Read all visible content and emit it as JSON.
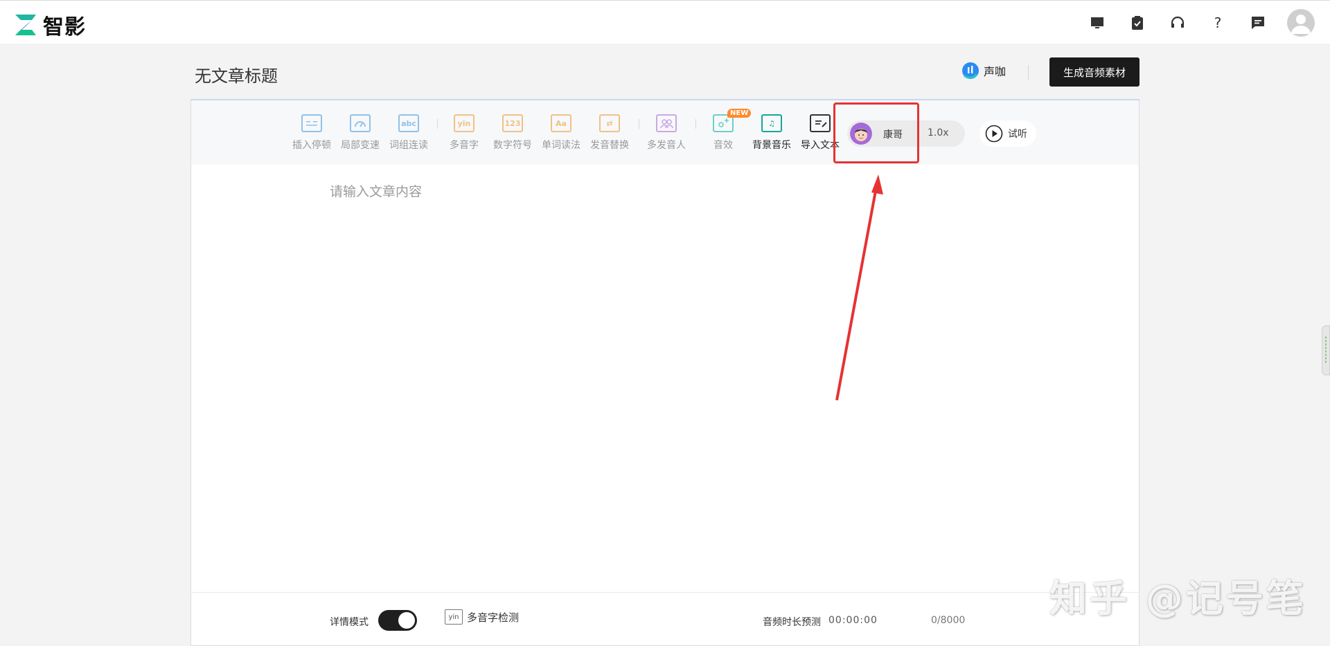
{
  "app": {
    "name": "智影"
  },
  "header": {
    "doc_title": "无文章标题",
    "shengka_label": "声咖",
    "generate_label": "生成音频素材"
  },
  "top_icons": [
    "monitor-icon",
    "clipboard-check-icon",
    "headset-icon",
    "help-icon",
    "message-icon"
  ],
  "toolbar": {
    "tools": [
      {
        "label": "插入停顿",
        "icon": "pause-insert-icon",
        "glyph": ""
      },
      {
        "label": "局部变速",
        "icon": "speed-gauge-icon",
        "glyph": ""
      },
      {
        "label": "词组连读",
        "icon": "abc-icon",
        "glyph": "abc"
      },
      {
        "label": "多音字",
        "icon": "yin-icon",
        "glyph": "yin"
      },
      {
        "label": "数字符号",
        "icon": "number-icon",
        "glyph": "123"
      },
      {
        "label": "单词读法",
        "icon": "word-aa-icon",
        "glyph": "Aa"
      },
      {
        "label": "发音替换",
        "icon": "replace-icon",
        "glyph": "⇄"
      },
      {
        "label": "多发音人",
        "icon": "multi-speaker-icon",
        "glyph": ""
      },
      {
        "label": "音效",
        "icon": "sound-effect-icon",
        "glyph": "",
        "badge": "NEW"
      },
      {
        "label": "背景音乐",
        "icon": "music-note-icon",
        "glyph": "♫"
      },
      {
        "label": "导入文本",
        "icon": "import-text-icon",
        "glyph": ""
      }
    ],
    "voice_name": "康哥",
    "speed": "1.0x",
    "play_label": "试听"
  },
  "editor": {
    "placeholder": "请输入文章内容"
  },
  "footer": {
    "detail_mode_label": "详情模式",
    "detail_mode_on": true,
    "polyphone_check_label": "多音字检测",
    "polyphone_icon_text": "yin",
    "duration_label": "音频时长预测",
    "duration_value": "00:00:00",
    "char_count": "0/8000"
  },
  "watermark": "知乎 @记号笔",
  "colors": {
    "accent_dark": "#1b1b1b",
    "annotation_red": "#e53333",
    "active_teal": "#12a89a"
  }
}
